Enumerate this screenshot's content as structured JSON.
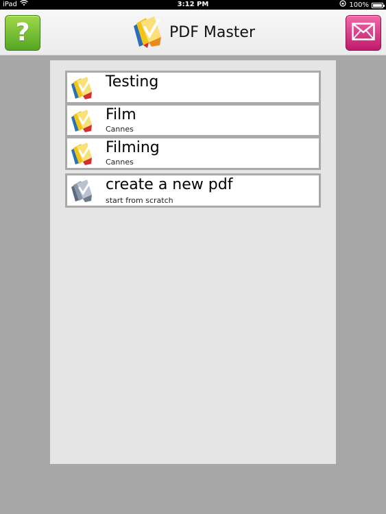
{
  "status_bar": {
    "device": "iPad",
    "time": "3:12 PM",
    "battery": "100%",
    "battery_level": 1.0
  },
  "toolbar": {
    "title": "PDF Master",
    "help_icon": "question-mark",
    "mail_icon": "envelope"
  },
  "documents": [
    {
      "title": "Testing",
      "subtitle": "",
      "icon": "pdf-document-icon"
    },
    {
      "title": "Film",
      "subtitle": "Cannes",
      "icon": "pdf-document-icon"
    },
    {
      "title": "Filming",
      "subtitle": "Cannes",
      "icon": "pdf-document-icon"
    }
  ],
  "create_item": {
    "title": "create a new pdf",
    "subtitle": "start from scratch",
    "icon": "new-pdf-icon"
  },
  "colors": {
    "help_button": "#6dbb2e",
    "mail_button": "#d92c82",
    "background": "#a7a7a7",
    "panel": "#e5e5e5"
  }
}
